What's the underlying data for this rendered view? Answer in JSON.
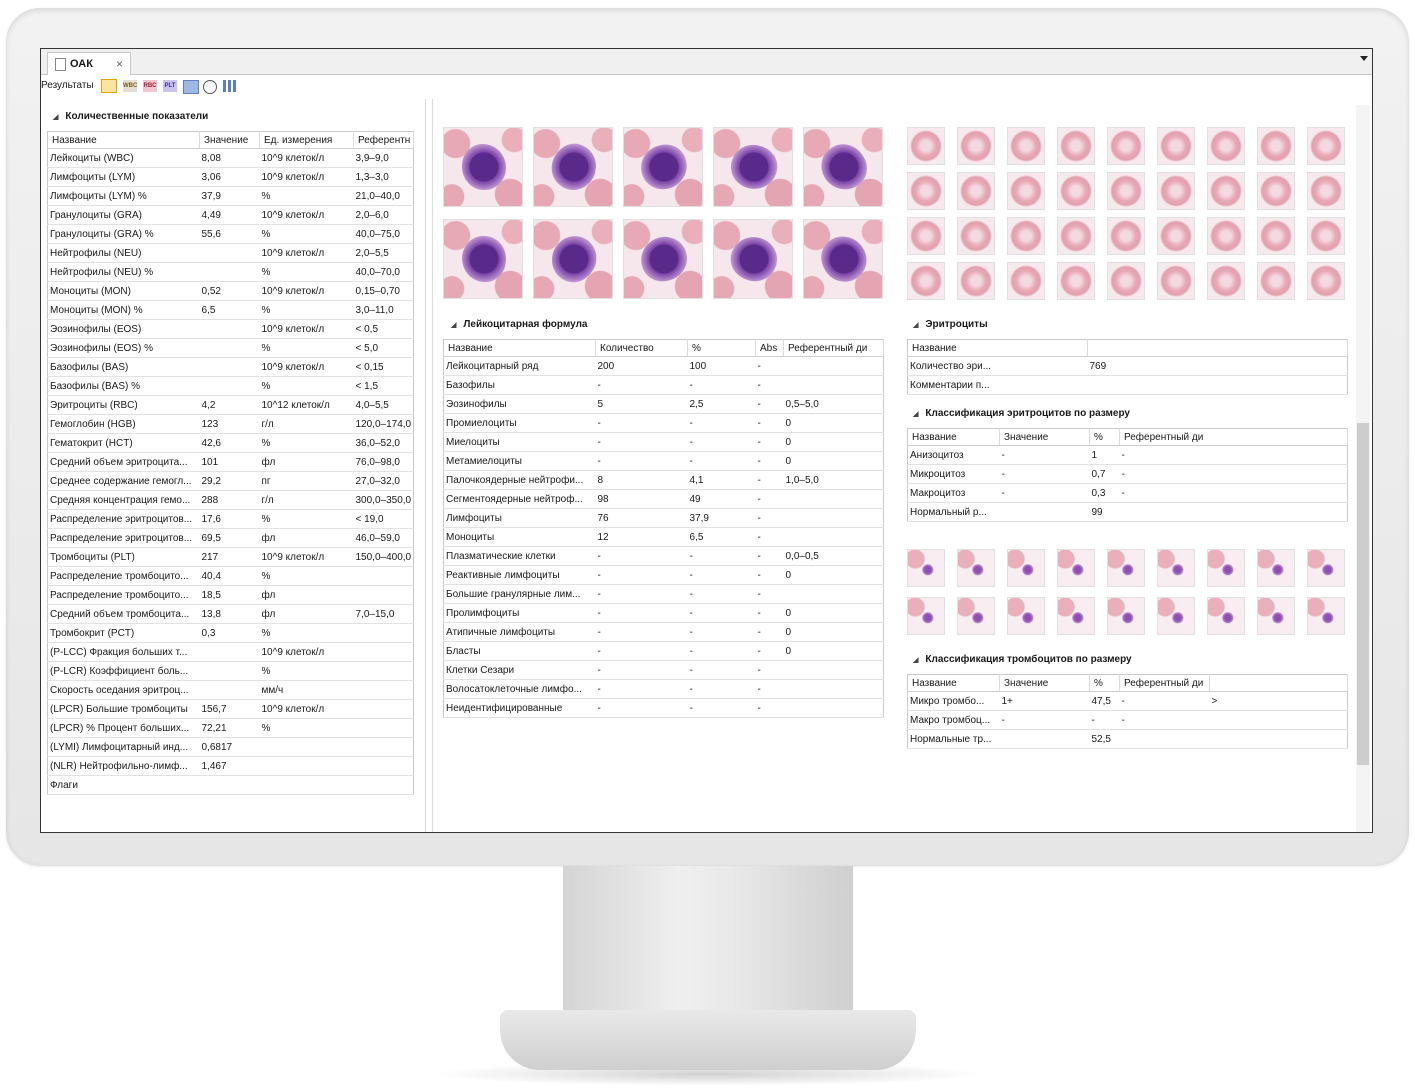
{
  "tab": {
    "label": "ОАК",
    "close": "×"
  },
  "toolbar": {
    "label": "Результаты",
    "icons": [
      {
        "name": "table-view-icon",
        "text": ""
      },
      {
        "name": "wbc-icon",
        "text": "WBC"
      },
      {
        "name": "rbc-icon",
        "text": "RBC"
      },
      {
        "name": "plt-icon",
        "text": "PLT"
      },
      {
        "name": "image-view-icon",
        "text": ""
      },
      {
        "name": "gauge-icon",
        "text": ""
      },
      {
        "name": "bar-chart-icon",
        "text": ""
      }
    ]
  },
  "left": {
    "title": "Количественные показатели",
    "headers": [
      "Название",
      "Значение",
      "Ед. измерения",
      "Референтн"
    ],
    "rows": [
      [
        "Лейкоциты (WBC)",
        "8,08",
        "10^9 клеток/л",
        "3,9–9,0"
      ],
      [
        "Лимфоциты (LYM)",
        "3,06",
        "10^9 клеток/л",
        "1,3–3,0"
      ],
      [
        "Лимфоциты (LYM) %",
        "37,9",
        "%",
        "21,0–40,0"
      ],
      [
        "Гранулоциты (GRA)",
        "4,49",
        "10^9 клеток/л",
        "2,0–6,0"
      ],
      [
        "Гранулоциты (GRA) %",
        "55,6",
        "%",
        "40,0–75,0"
      ],
      [
        "Нейтрофилы (NEU)",
        "",
        "10^9 клеток/л",
        "2,0–5,5"
      ],
      [
        "Нейтрофилы (NEU) %",
        "",
        "%",
        "40,0–70,0"
      ],
      [
        "Моноциты (MON)",
        "0,52",
        "10^9 клеток/л",
        "0,15–0,70"
      ],
      [
        "Моноциты (MON) %",
        "6,5",
        "%",
        "3,0–11,0"
      ],
      [
        "Эозинофилы (EOS)",
        "",
        "10^9 клеток/л",
        "< 0,5"
      ],
      [
        "Эозинофилы (EOS) %",
        "",
        "%",
        "< 5,0"
      ],
      [
        "Базофилы (BAS)",
        "",
        "10^9 клеток/л",
        "< 0,15"
      ],
      [
        "Базофилы (BAS) %",
        "",
        "%",
        "< 1,5"
      ],
      [
        "Эритроциты (RBC)",
        "4,2",
        "10^12 клеток/л",
        "4,0–5,5"
      ],
      [
        "Гемоглобин (HGB)",
        "123",
        "г/л",
        "120,0–174,0"
      ],
      [
        "Гематокрит (HCT)",
        "42,6",
        "%",
        "36,0–52,0"
      ],
      [
        "Средний объем эритроцита...",
        "101",
        "фл",
        "76,0–98,0"
      ],
      [
        "Среднее содержание гемогл...",
        "29,2",
        "пг",
        "27,0–32,0"
      ],
      [
        "Средняя концентрация гемо...",
        "288",
        "г/л",
        "300,0–350,0"
      ],
      [
        "Распределение эритроцитов...",
        "17,6",
        "%",
        "< 19,0"
      ],
      [
        "Распределение эритроцитов...",
        "69,5",
        "фл",
        "46,0–59,0"
      ],
      [
        "Тромбоциты (PLT)",
        "217",
        "10^9 клеток/л",
        "150,0–400,0"
      ],
      [
        "Распределение тромбоцито...",
        "40,4",
        "%",
        ""
      ],
      [
        "Распределение тромбоцито...",
        "18,5",
        "фл",
        ""
      ],
      [
        "Средний объем тромбоцита...",
        "13,8",
        "фл",
        "7,0–15,0"
      ],
      [
        "Тромбокрит (PCT)",
        "0,3",
        "%",
        ""
      ],
      [
        "(P-LCC) Фракция больших т...",
        "",
        "10^9 клеток/л",
        ""
      ],
      [
        "(P-LCR) Коэффициент боль...",
        "",
        "%",
        ""
      ],
      [
        "Скорость оседания эритроц...",
        "",
        "мм/ч",
        ""
      ],
      [
        "(LPCR) Большие тромбоциты",
        "156,7",
        "10^9 клеток/л",
        ""
      ],
      [
        "(LPCR) % Процент больших...",
        "72,21",
        "%",
        ""
      ],
      [
        "(LYMI) Лимфоцитарный инд...",
        "0,6817",
        "",
        ""
      ],
      [
        "(NLR) Нейтрофильно-лимф...",
        "1,467",
        "",
        ""
      ],
      [
        "Флаги",
        "",
        "",
        ""
      ]
    ]
  },
  "leuko": {
    "title": "Лейкоцитарная формула",
    "headers": [
      "Название",
      "Количество",
      "%",
      "Abs",
      "Референтный ди"
    ],
    "rows": [
      [
        "Лейкоцитарный ряд",
        "200",
        "100",
        "-",
        ""
      ],
      [
        "Базофилы",
        "-",
        "-",
        "-",
        ""
      ],
      [
        "Эозинофилы",
        "5",
        "2,5",
        "-",
        "0,5–5,0"
      ],
      [
        "Промиелоциты",
        "-",
        "-",
        "-",
        "0"
      ],
      [
        "Миелоциты",
        "-",
        "-",
        "-",
        "0"
      ],
      [
        "Метамиелоциты",
        "-",
        "-",
        "-",
        "0"
      ],
      [
        "Палочкоядерные нейтрофи...",
        "8",
        "4,1",
        "-",
        "1,0–5,0"
      ],
      [
        "Сегментоядерные нейтроф...",
        "98",
        "49",
        "-",
        ""
      ],
      [
        "Лимфоциты",
        "76",
        "37,9",
        "-",
        ""
      ],
      [
        "Моноциты",
        "12",
        "6,5",
        "-",
        ""
      ],
      [
        "Плазматические клетки",
        "-",
        "-",
        "-",
        "0,0–0,5"
      ],
      [
        "Реактивные лимфоциты",
        "-",
        "-",
        "-",
        "0"
      ],
      [
        "Большие гранулярные лим...",
        "-",
        "-",
        "-",
        ""
      ],
      [
        "Пролимфоциты",
        "-",
        "-",
        "-",
        "0"
      ],
      [
        "Атипичные лимфоциты",
        "-",
        "-",
        "-",
        "0"
      ],
      [
        "Бласты",
        "-",
        "-",
        "-",
        "0"
      ],
      [
        "Клетки Сезари",
        "-",
        "-",
        "-",
        ""
      ],
      [
        "Волосатоклеточные лимфо...",
        "-",
        "-",
        "-",
        ""
      ],
      [
        "Неидентифицированные",
        "-",
        "-",
        "-",
        ""
      ]
    ]
  },
  "erythro": {
    "title": "Эритроциты",
    "headers": [
      "Название",
      ""
    ],
    "rows": [
      [
        "Количество эри...",
        "769"
      ],
      [
        "Комментарии п...",
        ""
      ]
    ]
  },
  "rbcsize": {
    "title": "Классификация эритроцитов по размеру",
    "headers": [
      "Название",
      "Значение",
      "%",
      "Референтный ди"
    ],
    "rows": [
      [
        "Анизоцитоз",
        "-",
        "1",
        "-"
      ],
      [
        "Микроцитоз",
        "-",
        "0,7",
        "-"
      ],
      [
        "Макроцитоз",
        "-",
        "0,3",
        "-"
      ],
      [
        "Нормальный р...",
        "",
        "99",
        ""
      ]
    ]
  },
  "pltsize": {
    "title": "Классификация тромбоцитов по размеру",
    "headers": [
      "Название",
      "Значение",
      "%",
      "Референтный ди"
    ],
    "rows": [
      [
        "Микро тромбо...",
        "1+",
        "47,5",
        "-",
        ">"
      ],
      [
        "Макро тромбоц...",
        "-",
        "-",
        "-",
        ""
      ],
      [
        "Нормальные тр...",
        "",
        "52,5",
        "",
        ""
      ]
    ]
  }
}
